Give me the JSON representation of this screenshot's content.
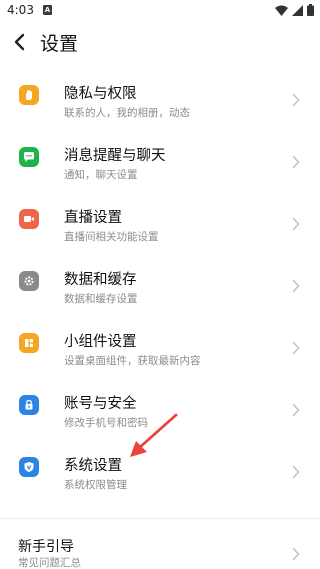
{
  "status_bar": {
    "time": "4:03",
    "notification_glyph": "A"
  },
  "header": {
    "title": "设置"
  },
  "items": [
    {
      "title": "隐私与权限",
      "subtitle": "联系的人，我的相册，动态",
      "icon": "hand-icon",
      "color": "#f5a623"
    },
    {
      "title": "消息提醒与聊天",
      "subtitle": "通知，聊天设置",
      "icon": "chat-bubble-icon",
      "color": "#22b14c"
    },
    {
      "title": "直播设置",
      "subtitle": "直播间相关功能设置",
      "icon": "video-camera-icon",
      "color": "#f0644a"
    },
    {
      "title": "数据和缓存",
      "subtitle": "数据和缓存设置",
      "icon": "gear-icon",
      "color": "#8a8a8a"
    },
    {
      "title": "小组件设置",
      "subtitle": "设置桌面组件，获取最新内容",
      "icon": "widget-icon",
      "color": "#f5a623"
    },
    {
      "title": "账号与安全",
      "subtitle": "修改手机号和密码",
      "icon": "lock-icon",
      "color": "#2d84e5"
    },
    {
      "title": "系统设置",
      "subtitle": "系统权限管理",
      "icon": "shield-icon",
      "color": "#2d84e5"
    }
  ],
  "guide": {
    "title": "新手引导",
    "subtitle": "常见问题汇总"
  },
  "annotation": {
    "color": "#e8453c"
  }
}
